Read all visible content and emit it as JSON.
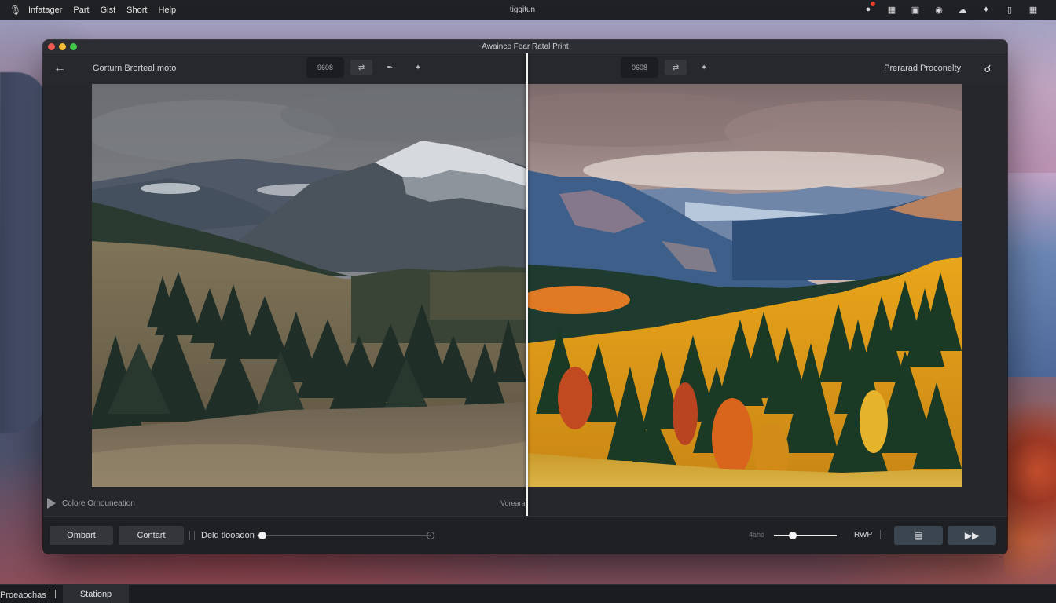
{
  "menubar": {
    "items": [
      "Infatager",
      "Part",
      "Gist",
      "Short",
      "Help"
    ],
    "center_title": "tiggitun"
  },
  "window": {
    "title": "Awaince Fear Ratal Print"
  },
  "toolbar": {
    "left_title": "Gorturn Brorteal moto",
    "left_segment_label": "9608",
    "right_segment_label": "0608",
    "right_title": "Prerarad Proconelty"
  },
  "info": {
    "left_label": "Colore Ornouneation",
    "center_label": "Vorearal"
  },
  "bottom": {
    "button_1": "Ombart",
    "button_2": "Contart",
    "slider_label": "Deld tlooadon",
    "slider_value_percent": 3,
    "volume_label": "4aho",
    "volume_value_percent": 30,
    "mode_label": "RWP"
  },
  "taskbar": {
    "item_1": "Proeaochas",
    "item_2": "Stationp"
  },
  "colors": {
    "accent_button": "#3a4550",
    "notification": "#e5402f",
    "divider": "#f2f2f2"
  }
}
